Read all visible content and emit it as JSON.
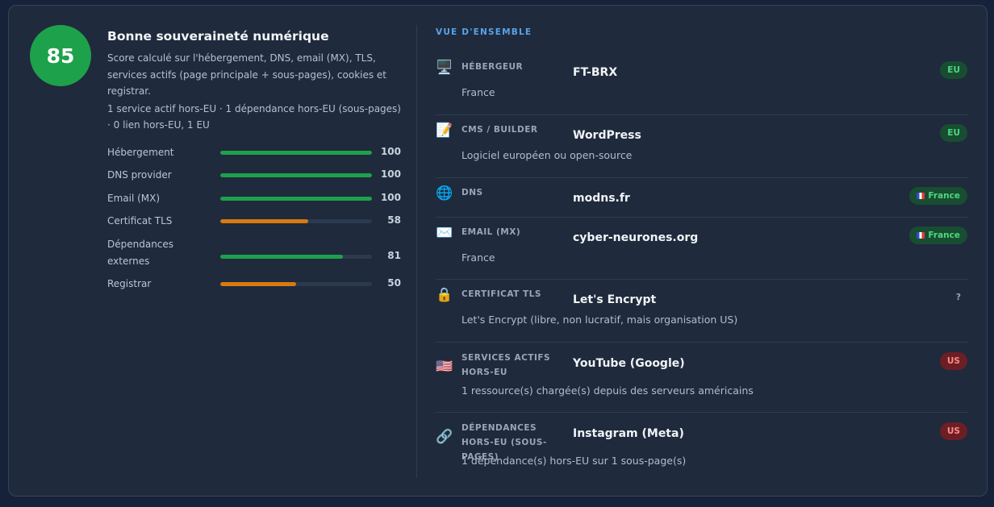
{
  "summary": {
    "score": "85",
    "title": "Bonne souveraineté numérique",
    "description": "Score calculé sur l'hébergement, DNS, email (MX), TLS, services actifs (page principale + sous-pages), cookies et registrar.",
    "stats": "1 service actif hors-EU · 1 dépendance hors-EU (sous-pages) · 0 lien hors-EU, 1 EU"
  },
  "metrics": [
    {
      "label": "Hébergement",
      "value": "100",
      "fraction": 1.0,
      "color": "#1ea14b"
    },
    {
      "label": "DNS provider",
      "value": "100",
      "fraction": 1.0,
      "color": "#1ea14b"
    },
    {
      "label": "Email (MX)",
      "value": "100",
      "fraction": 1.0,
      "color": "#1ea14b"
    },
    {
      "label": "Certificat TLS",
      "value": "58",
      "fraction": 0.58,
      "color": "#d97a0f"
    },
    {
      "label": "Dépendances externes",
      "value": "81",
      "fraction": 0.81,
      "color": "#1ea14b"
    },
    {
      "label": "Registrar",
      "value": "50",
      "fraction": 0.5,
      "color": "#d97a0f"
    }
  ],
  "overview": {
    "title": "VUE D'ENSEMBLE",
    "rows": [
      {
        "icon": "desktop-icon",
        "glyph": "🖥️",
        "category": "Hébergeur",
        "value": "FT-BRX",
        "badge": "EU",
        "badge_type": "eu",
        "note": "France"
      },
      {
        "icon": "memo-icon",
        "glyph": "📝",
        "category": "CMS / Builder",
        "value": "WordPress",
        "badge": "EU",
        "badge_type": "eu",
        "note": "Logiciel européen ou open-source"
      },
      {
        "icon": "globe-icon",
        "glyph": "🌐",
        "category": "DNS",
        "value": "modns.fr",
        "badge": "France",
        "badge_type": "fr",
        "note": ""
      },
      {
        "icon": "envelope-icon",
        "glyph": "✉️",
        "category": "Email (MX)",
        "value": "cyber-neurones.org",
        "badge": "France",
        "badge_type": "fr",
        "note": "France"
      },
      {
        "icon": "lock-icon",
        "glyph": "🔒",
        "category": "Certificat TLS",
        "value": "Let's Encrypt",
        "badge": "?",
        "badge_type": "unk",
        "note": "Let's Encrypt (libre, non lucratif, mais organisation US)"
      },
      {
        "icon": "us-flag-icon",
        "glyph": "🇺🇸",
        "category": "Services actifs hors-EU",
        "value": "YouTube (Google)",
        "badge": "US",
        "badge_type": "us",
        "note": "1 ressource(s) chargée(s) depuis des serveurs américains"
      },
      {
        "icon": "link-icon",
        "glyph": "🔗",
        "category": "Dépendances hors-EU (sous-pages)",
        "value": "Instagram (Meta)",
        "badge": "US",
        "badge_type": "us",
        "note": "1 dépendance(s) hors-EU sur 1 sous-page(s)"
      }
    ]
  }
}
